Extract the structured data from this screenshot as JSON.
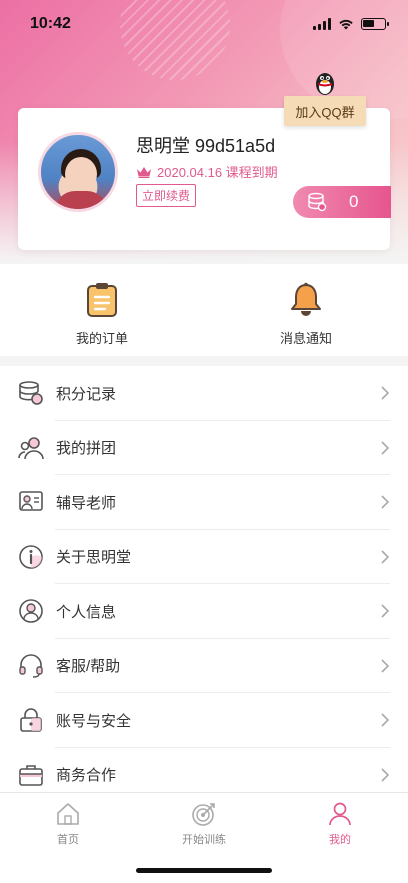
{
  "status_bar": {
    "time": "10:42"
  },
  "profile": {
    "username": "思明堂 99d51a5d",
    "expire_text": "2020.04.16 课程到期",
    "renew_label": "立即续费",
    "points": "0",
    "qq_group_label": "加入QQ群"
  },
  "quick": {
    "items": [
      {
        "label": "我的订单",
        "icon": "clipboard-icon"
      },
      {
        "label": "消息通知",
        "icon": "bell-icon"
      }
    ]
  },
  "menu": {
    "items": [
      {
        "label": "积分记录",
        "icon": "coins-icon"
      },
      {
        "label": "我的拼团",
        "icon": "group-icon"
      },
      {
        "label": "辅导老师",
        "icon": "teacher-icon"
      },
      {
        "label": "关于思明堂",
        "icon": "info-icon"
      },
      {
        "label": "个人信息",
        "icon": "user-icon"
      },
      {
        "label": "客服/帮助",
        "icon": "headset-icon"
      },
      {
        "label": "账号与安全",
        "icon": "lock-icon"
      },
      {
        "label": "商务合作",
        "icon": "briefcase-icon"
      }
    ]
  },
  "tabbar": {
    "items": [
      {
        "label": "首页",
        "icon": "home-icon"
      },
      {
        "label": "开始训练",
        "icon": "target-icon"
      },
      {
        "label": "我的",
        "icon": "profile-icon"
      }
    ],
    "active_color": "#e05a8f"
  },
  "colors": {
    "accent": "#e05a8f",
    "hero_start": "#ec6fa4",
    "hero_end": "#f9d7d3"
  }
}
